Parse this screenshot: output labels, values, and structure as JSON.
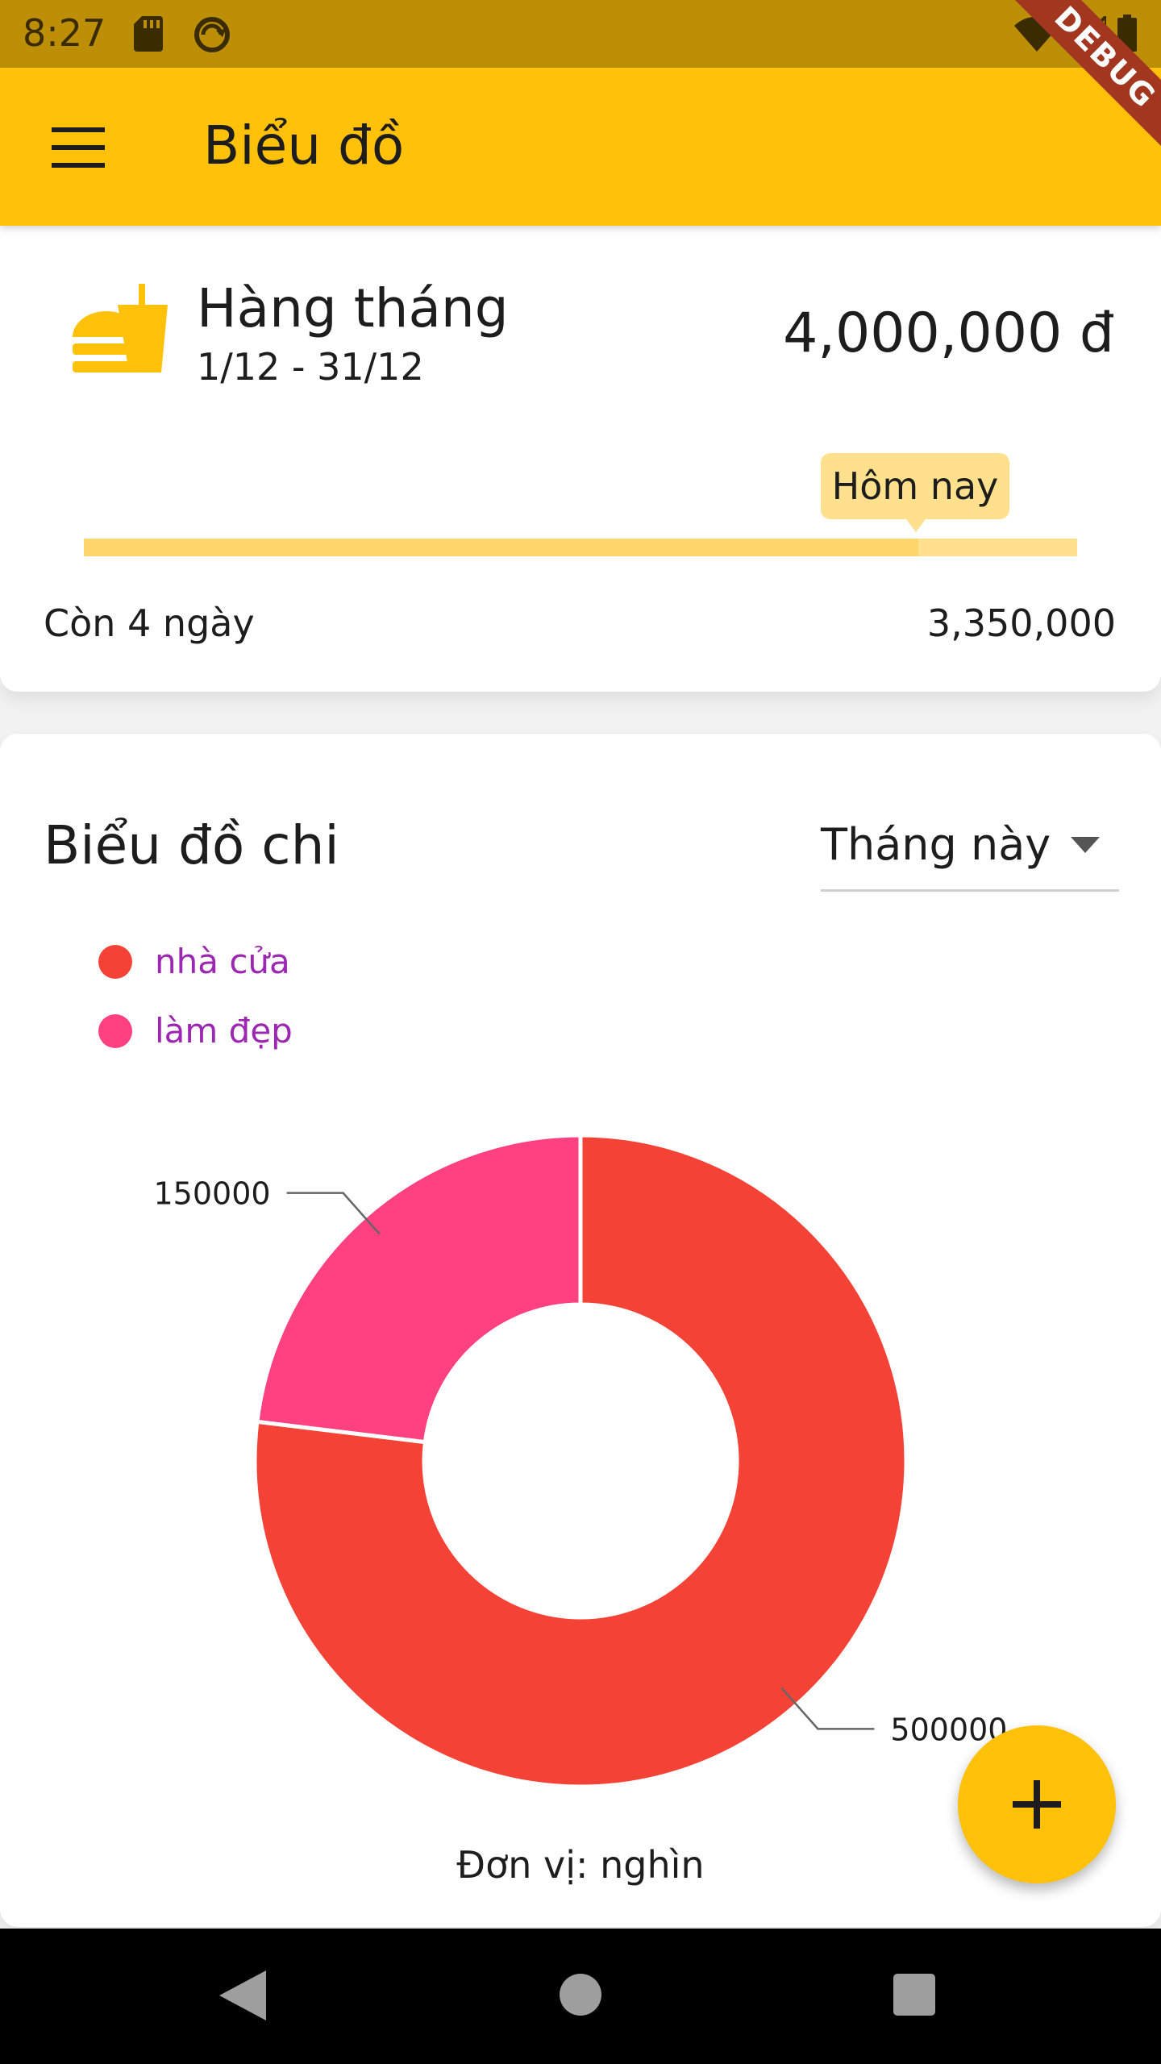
{
  "status_bar": {
    "time": "8:27",
    "icons": [
      "sd-card-icon",
      "sync-icon",
      "wifi-icon",
      "signal-icon",
      "battery-icon"
    ]
  },
  "debug_banner": "DEBUG",
  "app_bar": {
    "menu_icon": "menu-icon",
    "title": "Biểu đồ",
    "color": "#ffc10a"
  },
  "budget": {
    "icon": "fast-food-icon",
    "period": "Hàng tháng",
    "range": "1/12 - 31/12",
    "amount": "4,000,000 đ",
    "today_label": "Hôm nay",
    "progress_fraction": 0.84,
    "remaining_days": "Còn 4 ngày",
    "remaining_amount": "3,350,000"
  },
  "chart_section": {
    "title": "Biểu đồ chi",
    "period_select": "Tháng này",
    "unit_label": "Đơn vị: nghìn"
  },
  "chart_data": {
    "type": "pie",
    "donut": true,
    "labels": [
      "nhà cửa",
      "làm đẹp"
    ],
    "values": [
      500000,
      150000
    ],
    "value_labels": [
      "500000",
      "150000"
    ],
    "colors": [
      "#f44336",
      "#ff4081"
    ],
    "legend_position": "top-left",
    "legend_text_color": "#9c27b0",
    "unit": "nghìn"
  },
  "fab": {
    "icon": "plus-icon"
  },
  "nav_bar": {
    "icons": [
      "back-icon",
      "home-icon",
      "recent-apps-icon"
    ]
  }
}
